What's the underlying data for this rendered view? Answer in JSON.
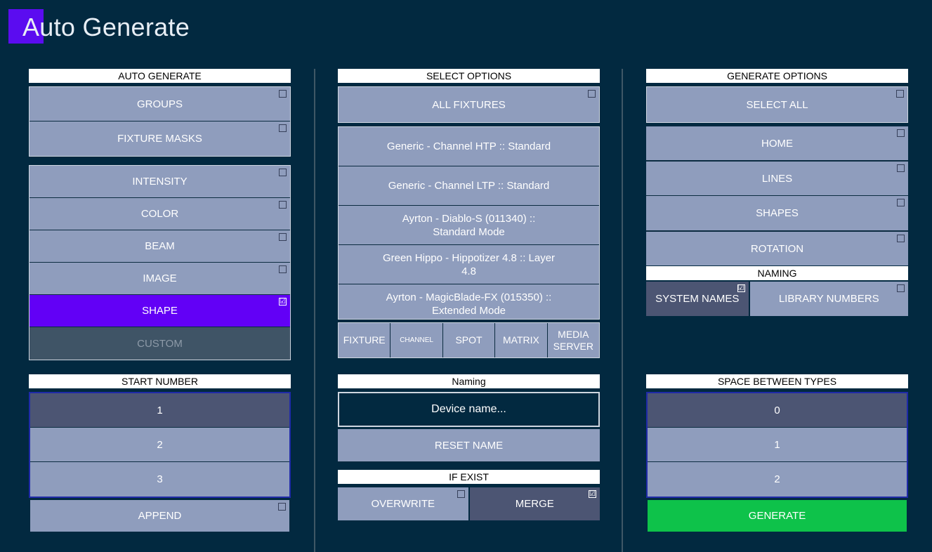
{
  "app": {
    "title": "Auto Generate"
  },
  "auto_generate": {
    "header": "AUTO GENERATE",
    "top": [
      {
        "label": "GROUPS",
        "checked": false
      },
      {
        "label": "FIXTURE MASKS",
        "checked": false
      }
    ],
    "features": [
      {
        "label": "INTENSITY",
        "checked": false
      },
      {
        "label": "COLOR",
        "checked": false
      },
      {
        "label": "BEAM",
        "checked": false
      },
      {
        "label": "IMAGE",
        "checked": false
      },
      {
        "label": "SHAPE",
        "checked": true
      },
      {
        "label": "CUSTOM",
        "checked": false
      }
    ]
  },
  "start_number": {
    "header": "START NUMBER",
    "options": [
      "1",
      "2",
      "3"
    ],
    "selected": "1",
    "append_label": "APPEND",
    "append_checked": false
  },
  "select_options": {
    "header": "SELECT OPTIONS",
    "all_fixtures_label": "ALL FIXTURES",
    "all_fixtures_checked": false,
    "fixtures": [
      "Generic - Channel HTP :: Standard",
      "Generic - Channel LTP :: Standard",
      "Ayrton - Diablo-S (011340) :: Standard Mode",
      "Green Hippo - Hippotizer 4.8 :: Layer 4.8",
      "Ayrton - MagicBlade-FX (015350) :: Extended Mode"
    ],
    "tabs": [
      "FIXTURE",
      "CHANNEL",
      "SPOT",
      "MATRIX",
      "MEDIA SERVER"
    ]
  },
  "naming_center": {
    "header": "Naming",
    "placeholder": "Device name...",
    "reset_label": "RESET NAME"
  },
  "if_exist": {
    "header": "IF EXIST",
    "overwrite_label": "OVERWRITE",
    "overwrite_checked": false,
    "merge_label": "MERGE",
    "merge_checked": true
  },
  "generate_options": {
    "header": "GENERATE OPTIONS",
    "select_all_label": "SELECT ALL",
    "select_all_checked": false,
    "options": [
      {
        "label": "HOME",
        "checked": false
      },
      {
        "label": "LINES",
        "checked": false
      },
      {
        "label": "SHAPES",
        "checked": false
      },
      {
        "label": "ROTATION",
        "checked": false
      }
    ]
  },
  "naming_right": {
    "header": "NAMING",
    "system_names_label": "SYSTEM NAMES",
    "system_names_checked": true,
    "library_numbers_label": "LIBRARY NUMBERS",
    "library_numbers_checked": false
  },
  "space_between_types": {
    "header": "SPACE BETWEEN TYPES",
    "options": [
      "0",
      "1",
      "2"
    ],
    "selected": "0"
  },
  "generate_label": "GENERATE",
  "checkmark_glyph": "☑",
  "colors": {
    "background": "#022940",
    "button": "#8f9dbd",
    "selected_button": "#6200f6",
    "dark_button": "#4c5573",
    "generate_button": "#0ec24a"
  }
}
